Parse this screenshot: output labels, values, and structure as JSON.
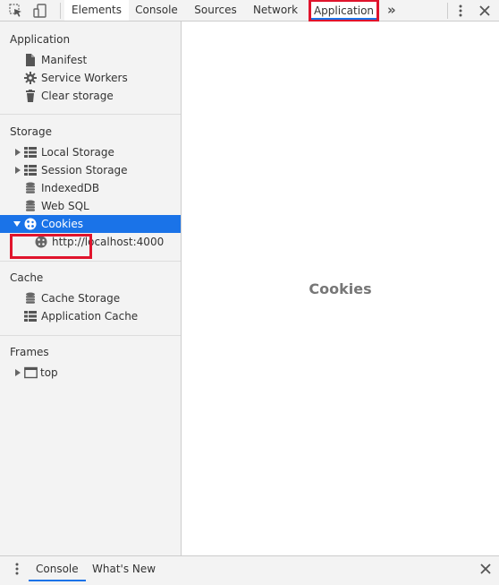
{
  "toolbar": {
    "tabs": [
      {
        "label": "Elements"
      },
      {
        "label": "Console"
      },
      {
        "label": "Sources"
      },
      {
        "label": "Network"
      },
      {
        "label": "Application"
      }
    ],
    "more_glyph": "»",
    "icons": [
      "inspect-element-icon",
      "device-toolbar-icon",
      "more-options-icon",
      "close-icon"
    ]
  },
  "sidebar": {
    "sections": [
      {
        "title": "Application",
        "items": [
          {
            "label": "Manifest",
            "icon": "file-icon"
          },
          {
            "label": "Service Workers",
            "icon": "gear-icon"
          },
          {
            "label": "Clear storage",
            "icon": "trash-icon"
          }
        ]
      },
      {
        "title": "Storage",
        "items": [
          {
            "label": "Local Storage",
            "icon": "grid-icon",
            "expandable": true
          },
          {
            "label": "Session Storage",
            "icon": "grid-icon",
            "expandable": true
          },
          {
            "label": "IndexedDB",
            "icon": "database-icon"
          },
          {
            "label": "Web SQL",
            "icon": "database-icon"
          },
          {
            "label": "Cookies",
            "icon": "cookie-icon",
            "expanded": true,
            "selected": true
          },
          {
            "label": "http://localhost:4000",
            "icon": "cookie-icon",
            "child": true
          }
        ]
      },
      {
        "title": "Cache",
        "items": [
          {
            "label": "Cache Storage",
            "icon": "database-icon"
          },
          {
            "label": "Application Cache",
            "icon": "grid-icon"
          }
        ]
      },
      {
        "title": "Frames",
        "items": [
          {
            "label": "top",
            "icon": "frame-icon",
            "expandable": true
          }
        ]
      }
    ]
  },
  "main": {
    "placeholder": "Cookies"
  },
  "drawer": {
    "tabs": [
      {
        "label": "Console"
      },
      {
        "label": "What's New"
      }
    ]
  },
  "colors": {
    "accent": "#1a73e8",
    "highlight": "#e0142c",
    "panel_bg": "#f3f3f3"
  }
}
